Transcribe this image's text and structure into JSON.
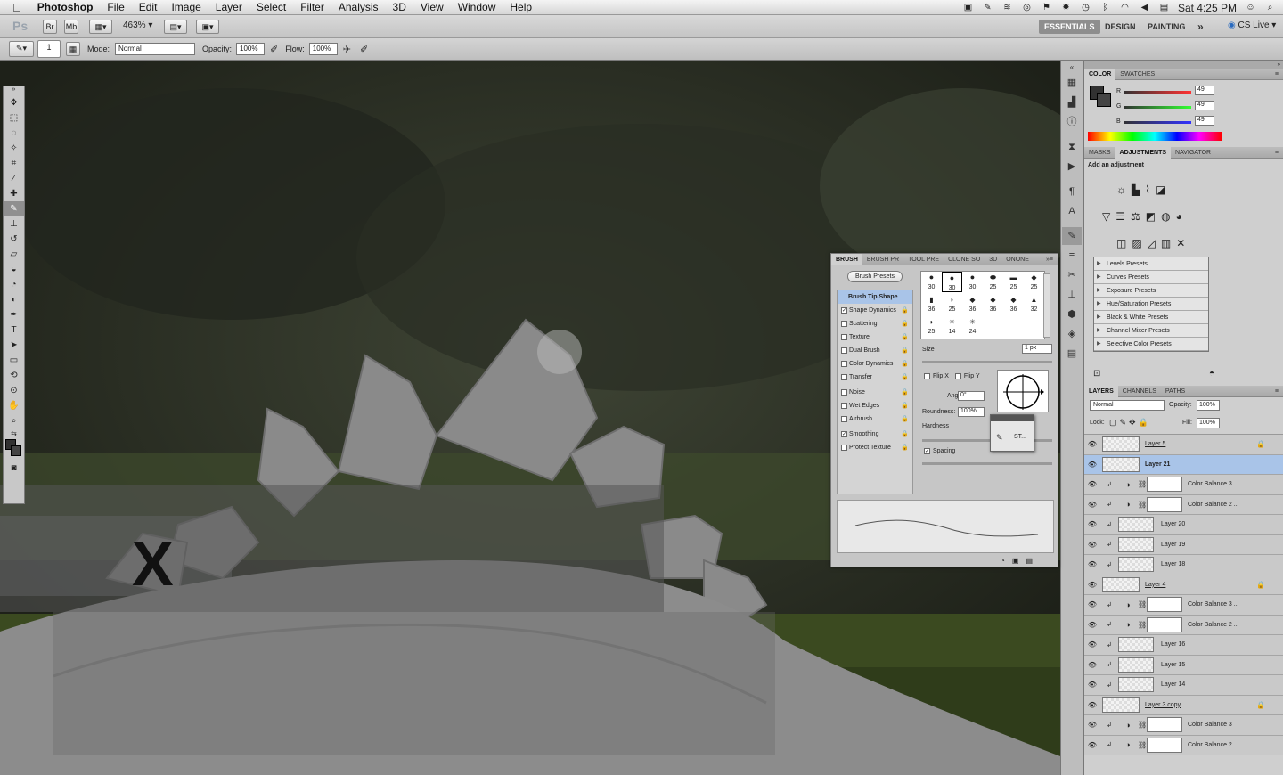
{
  "menubar": {
    "apple": "",
    "items": [
      "Photoshop",
      "File",
      "Edit",
      "Image",
      "Layer",
      "Select",
      "Filter",
      "Analysis",
      "3D",
      "View",
      "Window",
      "Help"
    ],
    "clock": "Sat 4:25 PM"
  },
  "appbar": {
    "logo": "Ps",
    "br": "Br",
    "mb": "Mb",
    "zoom": "463%",
    "workspaces": [
      "ESSENTIALS",
      "DESIGN",
      "PAINTING"
    ],
    "more": "»",
    "cslive": "CS Live"
  },
  "options": {
    "brush_size": "1",
    "mode_label": "Mode:",
    "mode_value": "Normal",
    "opacity_label": "Opacity:",
    "opacity_value": "100%",
    "flow_label": "Flow:",
    "flow_value": "100%"
  },
  "canvas": {
    "mark": "X"
  },
  "color_panel": {
    "tabs": [
      "COLOR",
      "SWATCHES"
    ],
    "r_label": "R",
    "r_value": "49",
    "g_label": "G",
    "g_value": "49",
    "b_label": "B",
    "b_value": "49",
    "fg_color": "#313131"
  },
  "adjustments_panel": {
    "tabs": [
      "MASKS",
      "ADJUSTMENTS",
      "NAVIGATOR"
    ],
    "heading": "Add an adjustment",
    "presets": [
      "Levels Presets",
      "Curves Presets",
      "Exposure Presets",
      "Hue/Saturation Presets",
      "Black & White Presets",
      "Channel Mixer Presets",
      "Selective Color Presets"
    ]
  },
  "layers_panel": {
    "tabs": [
      "LAYERS",
      "CHANNELS",
      "PATHS"
    ],
    "blend_mode": "Normal",
    "opacity_label": "Opacity:",
    "opacity_value": "100%",
    "lock_label": "Lock:",
    "fill_label": "Fill:",
    "fill_value": "100%",
    "layers": [
      {
        "name": "Layer 5",
        "type": "group",
        "lock": true
      },
      {
        "name": "Layer 21",
        "type": "pixel",
        "selected": true
      },
      {
        "name": "Color Balance 3 ...",
        "type": "adj"
      },
      {
        "name": "Color Balance 2 ...",
        "type": "adj"
      },
      {
        "name": "Layer 20",
        "type": "clip"
      },
      {
        "name": "Layer 19",
        "type": "clip"
      },
      {
        "name": "Layer 18",
        "type": "clip"
      },
      {
        "name": "Layer 4",
        "type": "group",
        "lock": true
      },
      {
        "name": "Color Balance 3 ...",
        "type": "adj"
      },
      {
        "name": "Color Balance 2 ...",
        "type": "adj"
      },
      {
        "name": "Layer 16",
        "type": "clip"
      },
      {
        "name": "Layer 15",
        "type": "clip"
      },
      {
        "name": "Layer 14",
        "type": "clip"
      },
      {
        "name": "Layer 3 copy",
        "type": "group",
        "lock": true
      },
      {
        "name": "Color Balance 3",
        "type": "adj"
      },
      {
        "name": "Color Balance 2",
        "type": "adj"
      }
    ]
  },
  "brush_panel": {
    "tabs": [
      "BRUSH",
      "BRUSH PR",
      "TOOL PRE",
      "CLONE SO",
      "3D",
      "ONONE"
    ],
    "presets_button": "Brush Presets",
    "options": [
      {
        "label": "Brush Tip Shape",
        "checked": null,
        "active": true
      },
      {
        "label": "Shape Dynamics",
        "checked": true
      },
      {
        "label": "Scattering",
        "checked": false
      },
      {
        "label": "Texture",
        "checked": false
      },
      {
        "label": "Dual Brush",
        "checked": false
      },
      {
        "label": "Color Dynamics",
        "checked": false
      },
      {
        "label": "Transfer",
        "checked": false
      },
      {
        "label": "Noise",
        "checked": false
      },
      {
        "label": "Wet Edges",
        "checked": false
      },
      {
        "label": "Airbrush",
        "checked": false
      },
      {
        "label": "Smoothing",
        "checked": true
      },
      {
        "label": "Protect Texture",
        "checked": false
      }
    ],
    "tip_sizes": [
      "30",
      "30",
      "30",
      "25",
      "25",
      "25",
      "36",
      "25",
      "36",
      "36",
      "36",
      "32",
      "25",
      "14",
      "24"
    ],
    "size_label": "Size",
    "size_value": "1 px",
    "flipx": "Flip X",
    "flipy": "Flip Y",
    "angle_label": "Angle:",
    "angle_value": "0°",
    "roundness_label": "Roundness:",
    "roundness_value": "100%",
    "hardness_label": "Hardness",
    "spacing_label": "Spacing",
    "popup_label": "ST..."
  }
}
